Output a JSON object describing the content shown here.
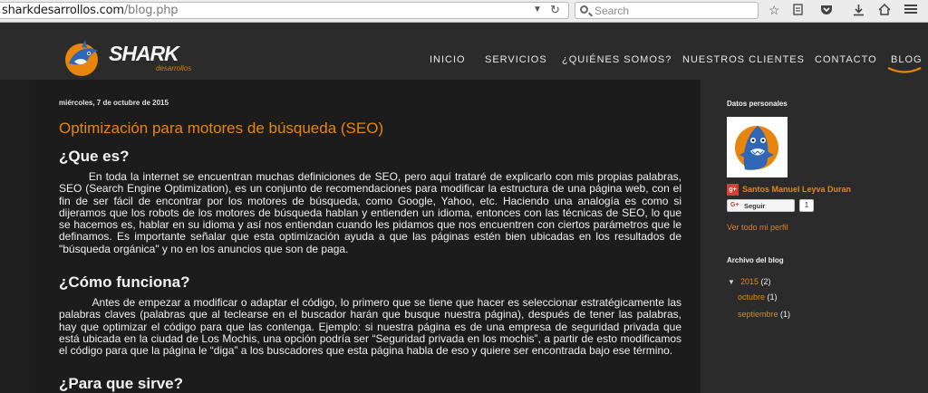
{
  "browser": {
    "url_host": "sharkdesarrollos.com",
    "url_path": "/blog.php",
    "search_placeholder": "Search",
    "icons": [
      "dropdown-icon",
      "reload-icon",
      "bookmark-star-icon",
      "reading-list-icon",
      "pocket-icon",
      "download-icon",
      "home-icon",
      "menu-icon"
    ]
  },
  "site": {
    "logo_text": "SHARK",
    "logo_sub": "desarrollos",
    "nav": [
      "INICIO",
      "SERVICIOS",
      "¿QUIÉNES SOMOS?",
      "NUESTROS CLIENTES",
      "CONTACTO",
      "BLOG"
    ],
    "accent": "#e8850d"
  },
  "post": {
    "date": "miércoles, 7 de octubre de 2015",
    "title": "Optimización para motores de búsqueda (SEO)",
    "h_que_es": "¿Que es?",
    "p1": "        En toda la internet se encuentran muchas definiciones de SEO, pero aquí trataré de explicarlo con mis propias palabras, SEO (Search Engine Optimization), es un conjunto de recomendaciones para modificar la estructura de una página web, con el fin de ser fácil de encontrar por los motores de búsqueda, como Google, Yahoo, etc. Haciendo una analogía es como si dijeramos que los robots de los motores de búsqueda hablan y entienden un idioma, entonces con las técnicas de SEO, lo que se hacemos es, hablar en su idioma y así nos entiendan cuando les pidamos que nos encuentren con ciertos parámetros que le definamos. Es importante señalar que esta optimización ayuda a que las páginas estén bien ubicadas en los resultados de \"búsqueda orgánica\" y no en los anuncios que son de paga.",
    "h_como": "¿Cómo funciona?",
    "p2": "          Antes de empezar a modificar o adaptar el código, lo primero que se tiene que hacer es seleccionar estratégicamente las palabras claves (palabras que al teclearse en el buscador harán que busque nuestra página), después de tener las palabras, hay que optimizar el código para que las contenga. Ejemplo: si nuestra página es de una empresa de seguridad privada que está ubicada en la ciudad de Los Mochis, una opción podría ser “Seguridad privada en los mochis”, a partir de esto modificamos el código para que la página le “diga” a los buscadores que esta página habla de eso y quiere ser encontrada bajo ese término.",
    "h_para": "¿Para que sirve?"
  },
  "sidebar": {
    "personal_title": "Datos personales",
    "gplus_label": "g+",
    "author": "Santos Manuel Leyva Duran",
    "follow_g": "G+",
    "follow_label": "Seguir",
    "follow_count": "1",
    "profile_link": "Ver todo mi perfil",
    "archive_title": "Archivo del blog",
    "archive_toggle": "▼",
    "year": "2015",
    "year_count": "(2)",
    "months": [
      {
        "name": "octubre",
        "count": "(1)"
      },
      {
        "name": "septiembre",
        "count": "(1)"
      }
    ]
  }
}
